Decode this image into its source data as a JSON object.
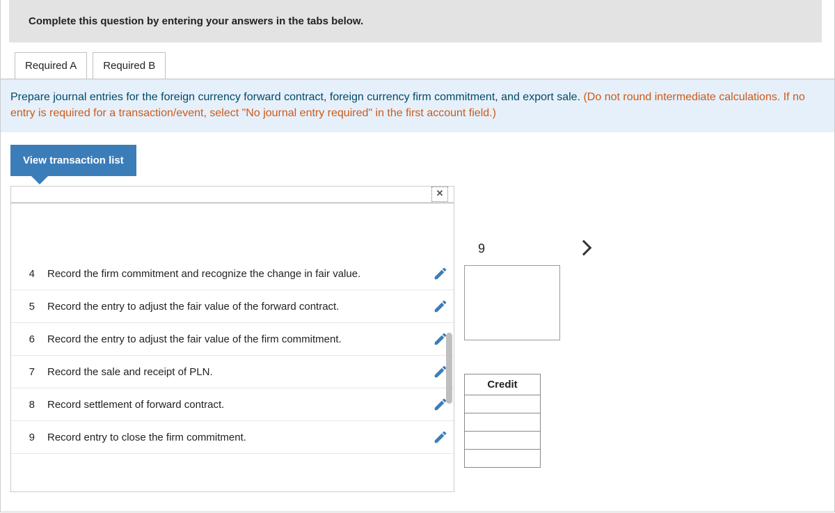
{
  "instruction": "Complete this question by entering your answers in the tabs below.",
  "tabs": [
    "Required A",
    "Required B"
  ],
  "prompt_main": "Prepare journal entries for the foreign currency forward contract, foreign currency firm commitment, and export sale. ",
  "prompt_note": "(Do not round intermediate calculations. If no entry is required for a transaction/event, select \"No journal entry required\" in the first account field.)",
  "view_transaction_list_label": "View transaction list",
  "transactions": [
    {
      "num": "4",
      "desc": "Record the firm commitment and recognize the change in fair value."
    },
    {
      "num": "5",
      "desc": "Record the entry to adjust the fair value of the forward contract."
    },
    {
      "num": "6",
      "desc": "Record the entry to adjust the fair value of the firm commitment."
    },
    {
      "num": "7",
      "desc": "Record the sale and receipt of PLN."
    },
    {
      "num": "8",
      "desc": "Record settlement of forward contract."
    },
    {
      "num": "9",
      "desc": "Record entry to close the firm commitment."
    }
  ],
  "pager_current": "9",
  "credit_header": "Credit"
}
